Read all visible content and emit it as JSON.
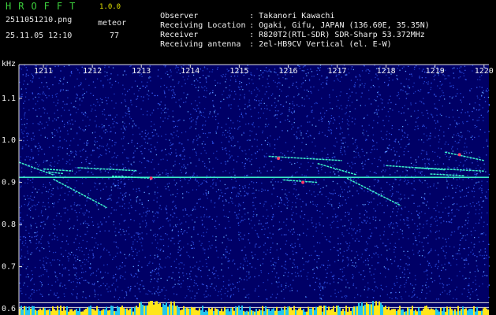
{
  "header": {
    "app_title": "HROFFT",
    "app_version": "1.0.0",
    "file_name": "2511051210.png",
    "meteor_label": "meteor",
    "timestamp": "25.11.05 12:10",
    "meteor_count": "77",
    "info": [
      {
        "key": "Observer",
        "value": "Takanori Kawachi"
      },
      {
        "key": "Receiving Location",
        "value": "Ogaki, Gifu, JAPAN (136.60E, 35.35N)"
      },
      {
        "key": "Receiver",
        "value": "R820T2(RTL-SDR) SDR-Sharp 53.372MHz"
      },
      {
        "key": "Receiving antenna",
        "value": "2el-HB9CV Vertical (el. E-W)"
      }
    ]
  },
  "chart_data": {
    "type": "spectrogram",
    "title": "",
    "xlabel": "",
    "ylabel": "kHz",
    "x_ticks": [
      "1211",
      "1212",
      "1213",
      "1214",
      "1215",
      "1216",
      "1217",
      "1218",
      "1219",
      "1220"
    ],
    "y_ticks": [
      "1.1",
      "1.0",
      "0.9",
      "0.8",
      "0.7",
      "0.6"
    ],
    "xlim": [
      1210.5,
      1220.1
    ],
    "ylim": [
      0.585,
      1.18
    ],
    "colors": {
      "background": "#000066",
      "noise": "#1f3cc8",
      "trace": "#3fffd0",
      "hot": "#ff3a6a",
      "strip_yellow": "#ffe61a",
      "strip_cyan": "#22c6ee"
    },
    "carrier_freq": 0.912,
    "meteor_traces": [
      {
        "t": [
          1210.5,
          1211.2
        ],
        "f": [
          0.948,
          0.918
        ]
      },
      {
        "t": [
          1211.0,
          1211.6
        ],
        "f": [
          0.932,
          0.927
        ]
      },
      {
        "t": [
          1211.1,
          1211.4
        ],
        "f": [
          0.925,
          0.921
        ]
      },
      {
        "t": [
          1211.2,
          1212.3
        ],
        "f": [
          0.908,
          0.84
        ]
      },
      {
        "t": [
          1211.7,
          1212.9
        ],
        "f": [
          0.935,
          0.928
        ]
      },
      {
        "t": [
          1212.4,
          1213.2
        ],
        "f": [
          0.915,
          0.91
        ]
      },
      {
        "t": [
          1215.6,
          1217.1
        ],
        "f": [
          0.962,
          0.952
        ]
      },
      {
        "t": [
          1215.9,
          1216.6
        ],
        "f": [
          0.906,
          0.9
        ]
      },
      {
        "t": [
          1216.6,
          1217.4
        ],
        "f": [
          0.945,
          0.918
        ]
      },
      {
        "t": [
          1217.2,
          1218.3
        ],
        "f": [
          0.91,
          0.845
        ]
      },
      {
        "t": [
          1218.0,
          1219.2
        ],
        "f": [
          0.94,
          0.93
        ]
      },
      {
        "t": [
          1218.6,
          1220.0
        ],
        "f": [
          0.935,
          0.927
        ]
      },
      {
        "t": [
          1218.9,
          1219.6
        ],
        "f": [
          0.92,
          0.916
        ]
      },
      {
        "t": [
          1219.2,
          1220.0
        ],
        "f": [
          0.972,
          0.952
        ]
      }
    ],
    "hot_spots": [
      {
        "t": 1213.2,
        "f": 0.91
      },
      {
        "t": 1215.8,
        "f": 0.957
      },
      {
        "t": 1219.5,
        "f": 0.966
      },
      {
        "t": 1216.3,
        "f": 0.9
      }
    ]
  }
}
